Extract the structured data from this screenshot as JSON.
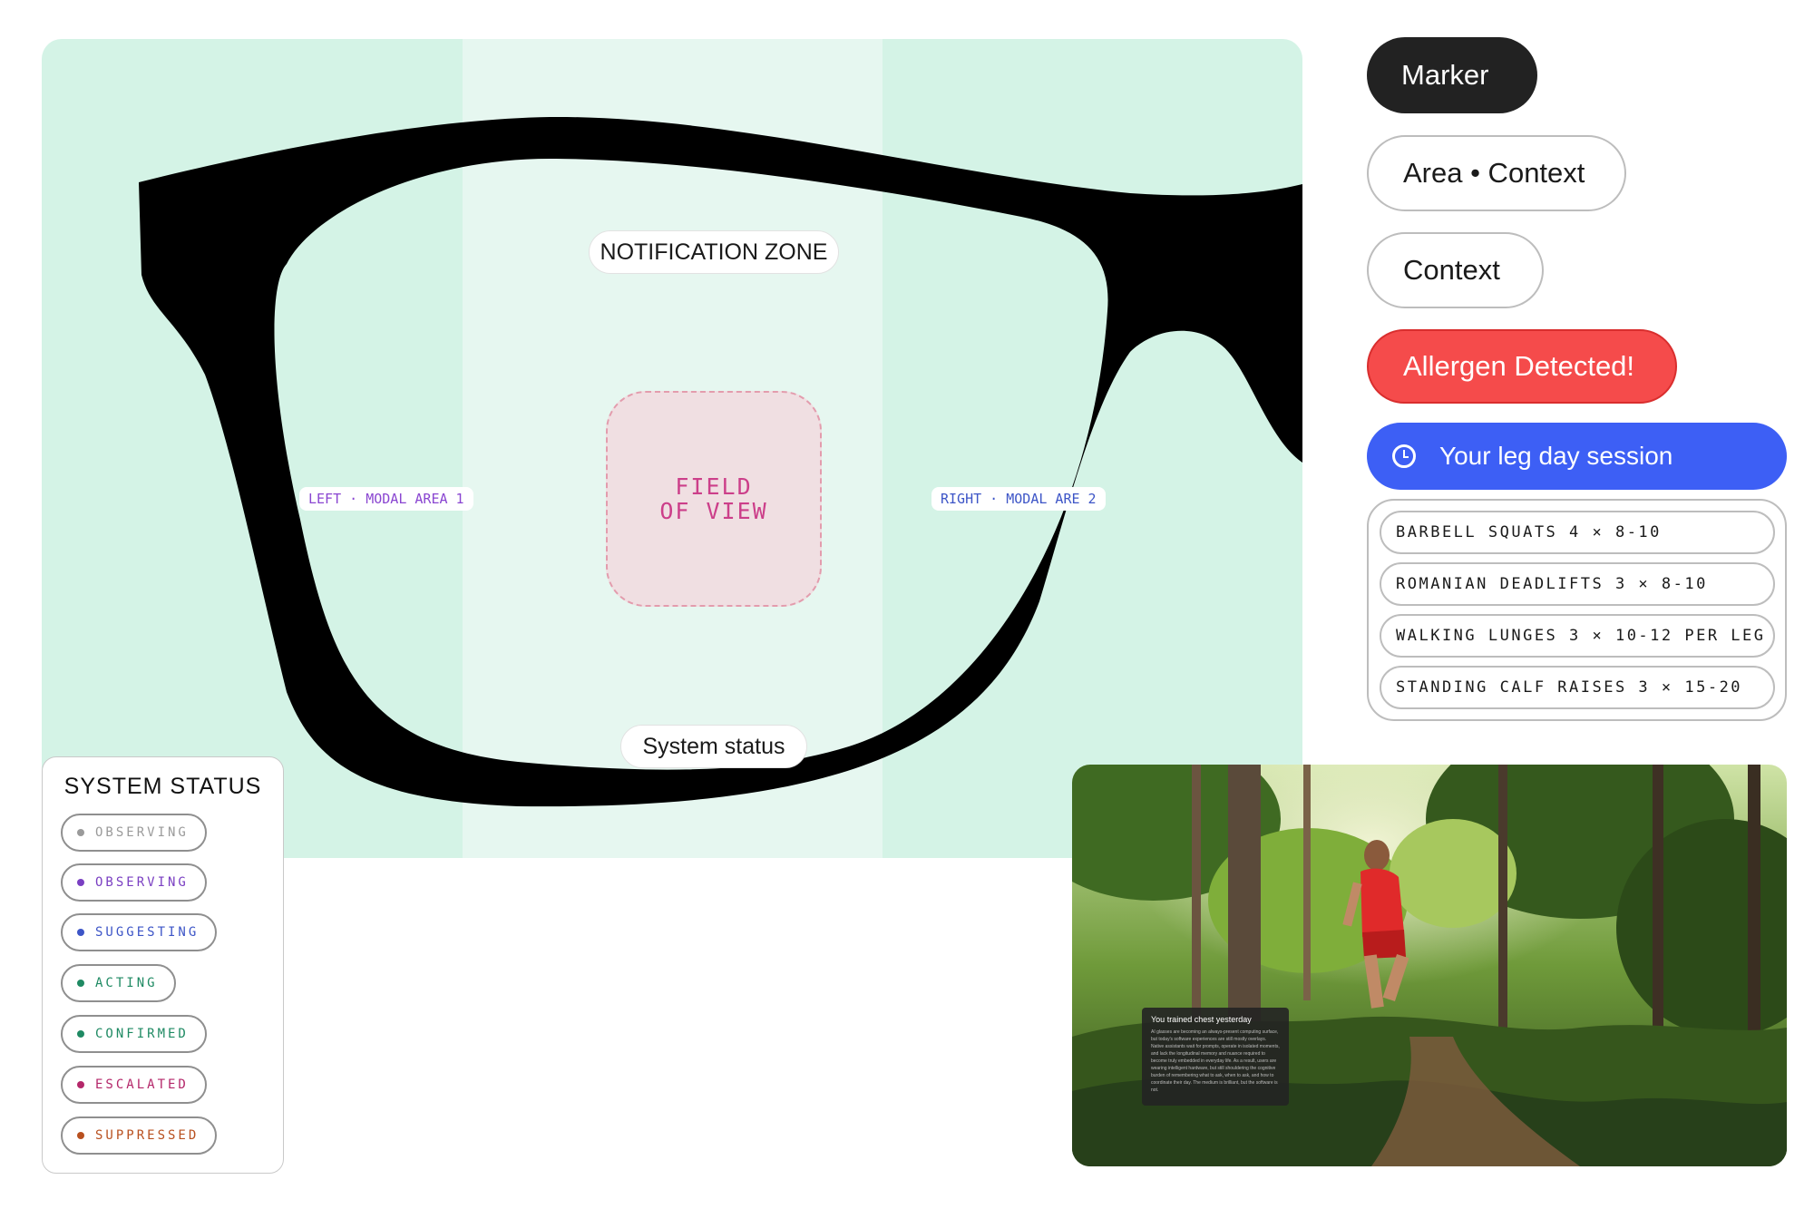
{
  "diagram": {
    "notification_zone": "NOTIFICATION ZONE",
    "left_modal": "LEFT · MODAL AREA 1",
    "right_modal": "RIGHT · MODAL ARE 2",
    "field_of_view_line1": "FIELD",
    "field_of_view_line2": "OF VIEW",
    "system_status": "System status"
  },
  "buttons": {
    "marker": "Marker",
    "area_context": "Area • Context",
    "context": "Context",
    "allergen": "Allergen Detected!",
    "session": "Your leg day session",
    "session_icon": "clock-icon"
  },
  "exercises": [
    "BARBELL SQUATS 4 × 8-10",
    "ROMANIAN DEADLIFTS 3 × 8-10",
    "WALKING LUNGES 3 × 10-12 PER LEG",
    "STANDING CALF RAISES 3 × 15-20"
  ],
  "status_card": {
    "title": "SYSTEM STATUS",
    "chips": [
      {
        "label": "OBSERVING",
        "color": "#9a9a9a"
      },
      {
        "label": "OBSERVING",
        "color": "#7a3fc2"
      },
      {
        "label": "SUGGESTING",
        "color": "#3d55c7"
      },
      {
        "label": "ACTING",
        "color": "#1f8a63"
      },
      {
        "label": "CONFIRMED",
        "color": "#1f8a63"
      },
      {
        "label": "ESCALATED",
        "color": "#b4276a"
      },
      {
        "label": "SUPPRESSED",
        "color": "#b8501f"
      }
    ]
  },
  "photo_overlay": {
    "title": "You trained chest yesterday",
    "body": "AI glasses are becoming an always-present computing surface, but today's software experiences are still mostly overlays. Native assistants wait for prompts, operate in isolated moments, and lack the longitudinal memory and nuance required to become truly embedded in everyday life. As a result, users are wearing intelligent hardware, but still shouldering the cognitive burden of remembering what to ask, when to ask, and how to coordinate their day. The medium is brilliant, but the software is not."
  },
  "colors": {
    "diagram_bg": "#d4f3e6",
    "marker_bg": "#222222",
    "allergen_bg": "#f54b4b",
    "session_bg": "#3d5ff5",
    "fov_text": "#cc3f8a"
  }
}
